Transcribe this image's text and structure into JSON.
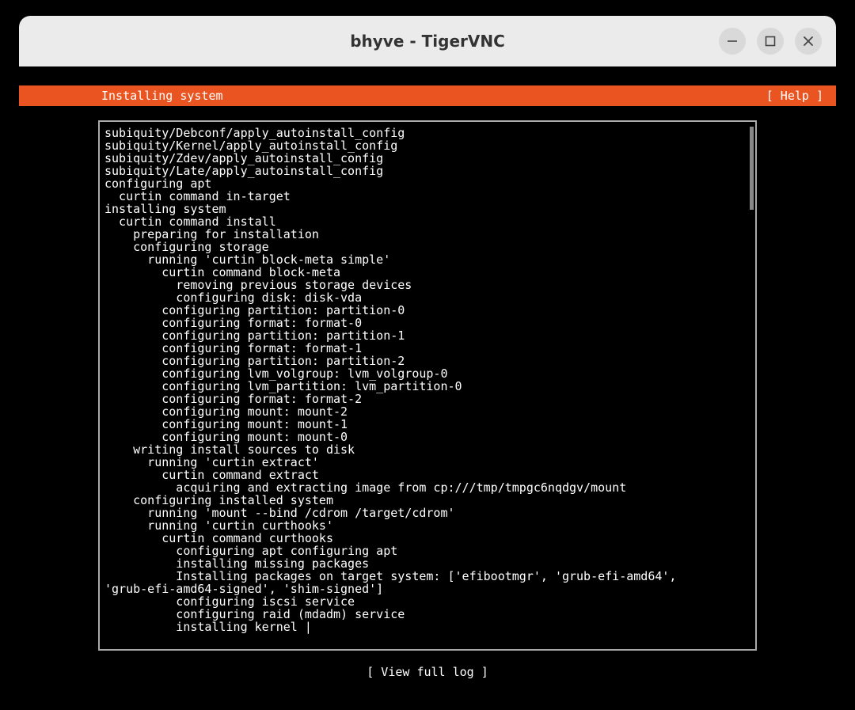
{
  "window": {
    "title": "bhyve - TigerVNC"
  },
  "header": {
    "title": "Installing system",
    "help": "[ Help ]"
  },
  "footer": {
    "view_full_log": "[ View full log ]"
  },
  "log": [
    {
      "indent": 0,
      "text": "subiquity/Debconf/apply_autoinstall_config"
    },
    {
      "indent": 0,
      "text": "subiquity/Kernel/apply_autoinstall_config"
    },
    {
      "indent": 0,
      "text": "subiquity/Zdev/apply_autoinstall_config"
    },
    {
      "indent": 0,
      "text": "subiquity/Late/apply_autoinstall_config"
    },
    {
      "indent": 0,
      "text": "configuring apt"
    },
    {
      "indent": 2,
      "text": "curtin command in-target"
    },
    {
      "indent": 0,
      "text": "installing system"
    },
    {
      "indent": 2,
      "text": "curtin command install"
    },
    {
      "indent": 4,
      "text": "preparing for installation"
    },
    {
      "indent": 4,
      "text": "configuring storage"
    },
    {
      "indent": 6,
      "text": "running 'curtin block-meta simple'"
    },
    {
      "indent": 8,
      "text": "curtin command block-meta"
    },
    {
      "indent": 10,
      "text": "removing previous storage devices"
    },
    {
      "indent": 10,
      "text": "configuring disk: disk-vda"
    },
    {
      "indent": 8,
      "text": "configuring partition: partition-0"
    },
    {
      "indent": 8,
      "text": "configuring format: format-0"
    },
    {
      "indent": 8,
      "text": "configuring partition: partition-1"
    },
    {
      "indent": 8,
      "text": "configuring format: format-1"
    },
    {
      "indent": 8,
      "text": "configuring partition: partition-2"
    },
    {
      "indent": 8,
      "text": "configuring lvm_volgroup: lvm_volgroup-0"
    },
    {
      "indent": 8,
      "text": "configuring lvm_partition: lvm_partition-0"
    },
    {
      "indent": 8,
      "text": "configuring format: format-2"
    },
    {
      "indent": 8,
      "text": "configuring mount: mount-2"
    },
    {
      "indent": 8,
      "text": "configuring mount: mount-1"
    },
    {
      "indent": 8,
      "text": "configuring mount: mount-0"
    },
    {
      "indent": 4,
      "text": "writing install sources to disk"
    },
    {
      "indent": 6,
      "text": "running 'curtin extract'"
    },
    {
      "indent": 8,
      "text": "curtin command extract"
    },
    {
      "indent": 10,
      "text": "acquiring and extracting image from cp:///tmp/tmpgc6nqdgv/mount"
    },
    {
      "indent": 4,
      "text": "configuring installed system"
    },
    {
      "indent": 6,
      "text": "running 'mount --bind /cdrom /target/cdrom'"
    },
    {
      "indent": 6,
      "text": "running 'curtin curthooks'"
    },
    {
      "indent": 8,
      "text": "curtin command curthooks"
    },
    {
      "indent": 10,
      "text": "configuring apt configuring apt"
    },
    {
      "indent": 10,
      "text": "installing missing packages"
    },
    {
      "indent": 10,
      "text": "Installing packages on target system: ['efibootmgr', 'grub-efi-amd64',"
    },
    {
      "indent": 0,
      "text": "'grub-efi-amd64-signed', 'shim-signed']"
    },
    {
      "indent": 10,
      "text": "configuring iscsi service"
    },
    {
      "indent": 10,
      "text": "configuring raid (mdadm) service"
    },
    {
      "indent": 10,
      "text": "installing kernel |"
    }
  ]
}
